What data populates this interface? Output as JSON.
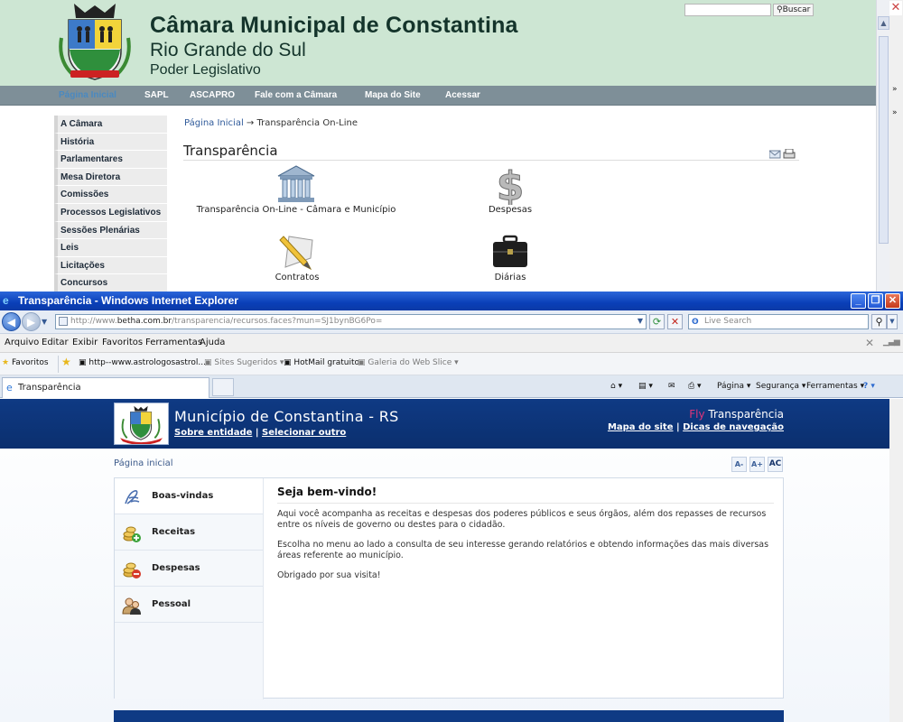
{
  "background_window": {
    "site_title": "Câmara Municipal de Constantina",
    "site_subtitle": "Rio Grande do Sul",
    "site_tagline": "Poder Legislativo",
    "search_button": "Buscar",
    "nav": [
      "Página Inicial",
      "SAPL",
      "ASCAPRO",
      "Fale com a Câmara",
      "Mapa do Site",
      "Acessar"
    ],
    "sidebar": [
      "A Câmara",
      "História",
      "Parlamentares",
      "Mesa Diretora",
      "Comissões",
      "Processos Legislativos",
      "Sessões Plenárias",
      "Leis",
      "Licitações",
      "Concursos"
    ],
    "breadcrumb_home": "Página Inicial",
    "breadcrumb_arrow": "→",
    "breadcrumb_current": "Transparência On-Line",
    "section_title": "Transparência",
    "tiles": [
      {
        "label": "Transparência On-Line - Câmara e Município",
        "icon": "building-icon"
      },
      {
        "label": "Despesas",
        "icon": "dollar-icon"
      },
      {
        "label": "Contratos",
        "icon": "pencil-icon"
      },
      {
        "label": "Diárias",
        "icon": "briefcase-icon"
      }
    ]
  },
  "ie": {
    "title": "Transparência - Windows Internet Explorer",
    "url_prefix": "http://www.",
    "url_domain": "betha.com.br",
    "url_rest": "/transparencia/recursos.faces?mun=SJ1bynBG6Po=",
    "search_placeholder": "Live Search",
    "menu": [
      "Arquivo",
      "Editar",
      "Exibir",
      "Favoritos",
      "Ferramentas",
      "Ajuda"
    ],
    "favorites_label": "Favoritos",
    "favorites": [
      "http--www.astrologosastrol...",
      "Sites Sugeridos",
      "HotMail gratuito",
      "Galeria do Web Slice"
    ],
    "tab_title": "Transparência",
    "commands": [
      "Página",
      "Segurança",
      "Ferramentas"
    ]
  },
  "page": {
    "title": "Município de Constantina - RS",
    "link_about": "Sobre entidade",
    "link_sep": "|",
    "link_select": "Selecionar outro",
    "fly": "Fly",
    "fly_product": "Transparência",
    "sitemap": "Mapa do site",
    "nav_tips": "Dicas de navegação",
    "breadcrumb": "Página inicial",
    "font_buttons": [
      "A-",
      "A+",
      "AC"
    ],
    "menu": [
      {
        "label": "Boas-vindas",
        "icon": "welcome-icon"
      },
      {
        "label": "Receitas",
        "icon": "coins-plus-icon"
      },
      {
        "label": "Despesas",
        "icon": "coins-minus-icon"
      },
      {
        "label": "Pessoal",
        "icon": "people-icon"
      }
    ],
    "welcome_heading": "Seja bem-vindo!",
    "paragraphs": [
      "Aqui você acompanha as receitas e despesas dos poderes públicos e seus órgãos, além dos repasses de recursos entre os níveis de governo ou destes para o cidadão.",
      "Escolha no menu ao lado a consulta de seu interesse gerando relatórios e obtendo informações das mais diversas áreas referente ao município.",
      "Obrigado por sua visita!"
    ]
  },
  "colors": {
    "site_header_bg": "#cde6d3",
    "site_nav_bg": "#7e8f98",
    "ie_titlebar": "#0a3fb8",
    "portal_header": "#0f3a84",
    "fly_accent": "#e0357a"
  }
}
